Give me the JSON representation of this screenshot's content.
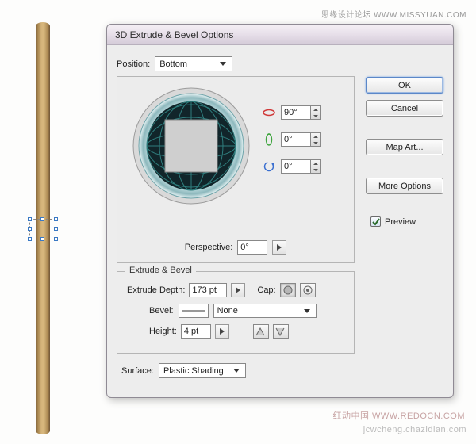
{
  "watermarks": {
    "top": "思缘设计论坛  WWW.MISSYUAN.COM",
    "bottom2": "红动中国  WWW.REDOCN.COM",
    "bottom": "jcwcheng.chazidian.com"
  },
  "dialog": {
    "title": "3D Extrude & Bevel Options",
    "position_label": "Position:",
    "position_value": "Bottom",
    "angles": {
      "x": "90°",
      "y": "0°",
      "z": "0°"
    },
    "perspective_label": "Perspective:",
    "perspective_value": "0°",
    "extrude_group": "Extrude & Bevel",
    "extrude_depth_label": "Extrude Depth:",
    "extrude_depth_value": "173 pt",
    "cap_label": "Cap:",
    "bevel_label": "Bevel:",
    "bevel_value": "None",
    "height_label": "Height:",
    "height_value": "4 pt",
    "surface_label": "Surface:",
    "surface_value": "Plastic Shading"
  },
  "buttons": {
    "ok": "OK",
    "cancel": "Cancel",
    "map_art": "Map Art...",
    "more_options": "More Options",
    "preview": "Preview"
  }
}
